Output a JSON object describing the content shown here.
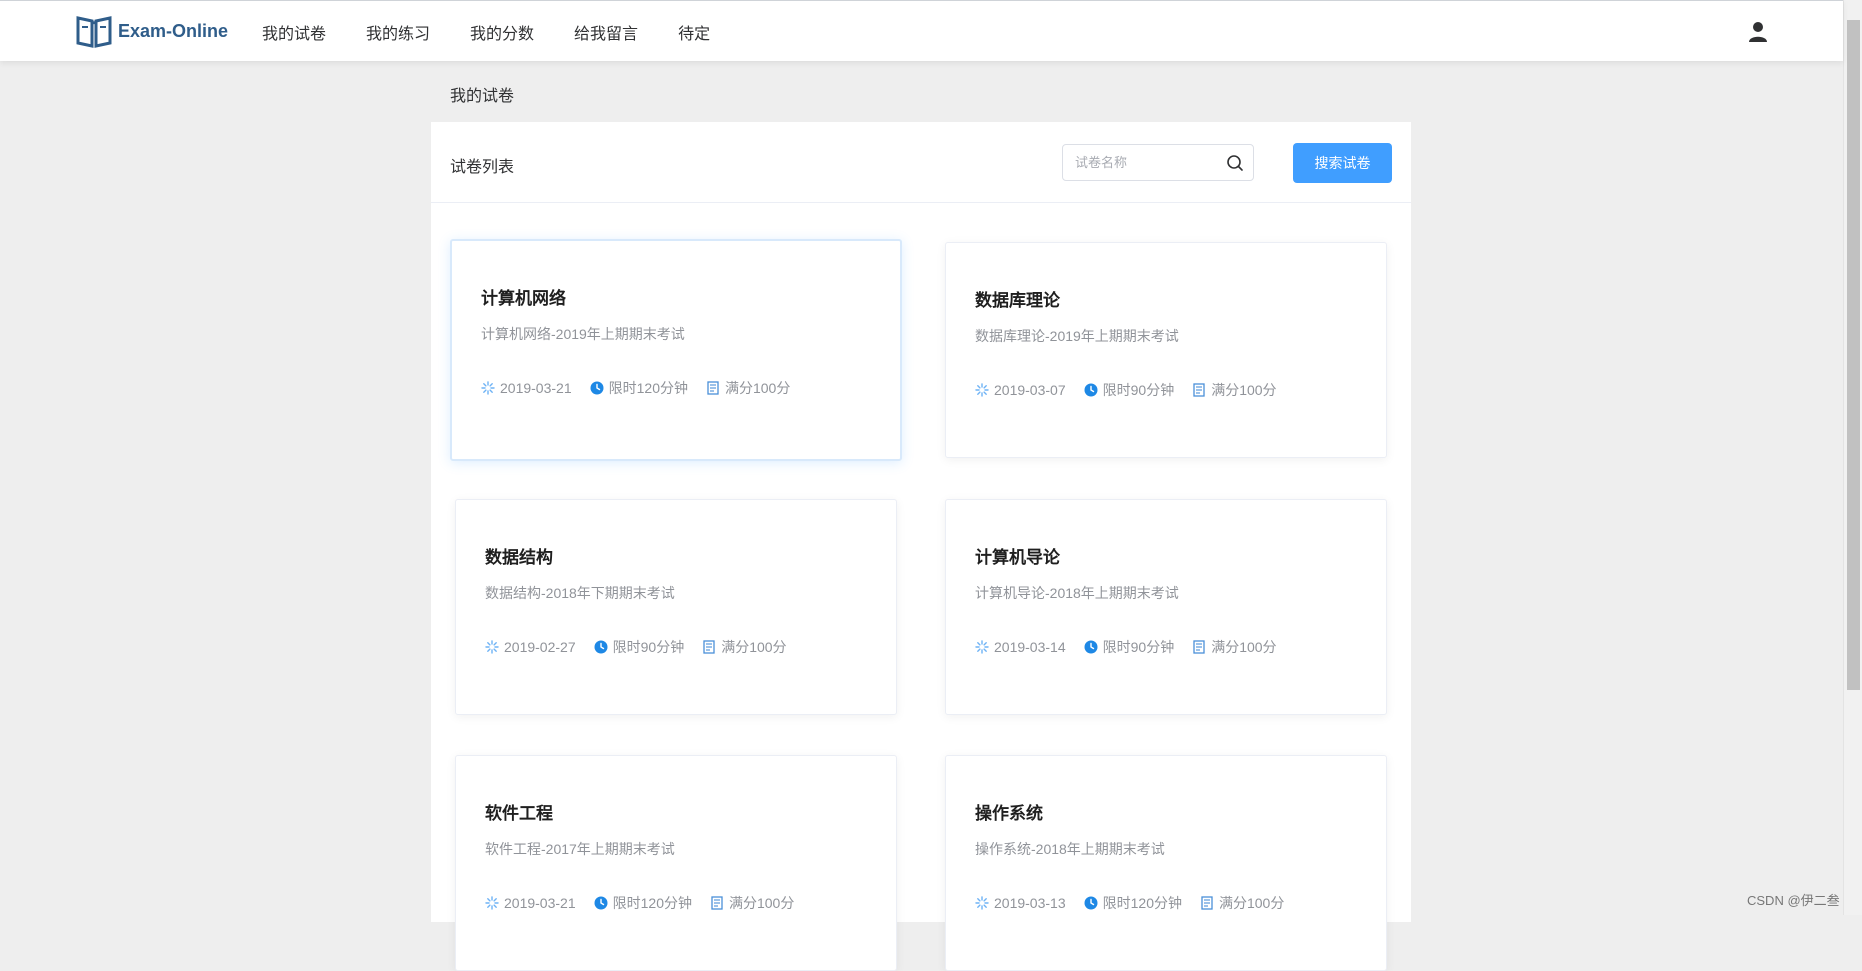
{
  "app": {
    "logo_text": "Exam-Online"
  },
  "nav": {
    "items": [
      {
        "label": "我的试卷"
      },
      {
        "label": "我的练习"
      },
      {
        "label": "我的分数"
      },
      {
        "label": "给我留言"
      },
      {
        "label": "待定"
      }
    ]
  },
  "breadcrumb": "我的试卷",
  "panel": {
    "title": "试卷列表",
    "search_placeholder": "试卷名称",
    "search_value": "",
    "search_button": "搜索试卷"
  },
  "papers": [
    {
      "title": "计算机网络",
      "desc": "计算机网络-2019年上期期末考试",
      "date": "2019-03-21",
      "limit": "限时120分钟",
      "score": "满分100分"
    },
    {
      "title": "数据库理论",
      "desc": "数据库理论-2019年上期期末考试",
      "date": "2019-03-07",
      "limit": "限时90分钟",
      "score": "满分100分"
    },
    {
      "title": "数据结构",
      "desc": "数据结构-2018年下期期末考试",
      "date": "2019-02-27",
      "limit": "限时90分钟",
      "score": "满分100分"
    },
    {
      "title": "计算机导论",
      "desc": "计算机导论-2018年上期期末考试",
      "date": "2019-03-14",
      "limit": "限时90分钟",
      "score": "满分100分"
    },
    {
      "title": "软件工程",
      "desc": "软件工程-2017年上期期末考试",
      "date": "2019-03-21",
      "limit": "限时120分钟",
      "score": "满分100分"
    },
    {
      "title": "操作系统",
      "desc": "操作系统-2018年上期期末考试",
      "date": "2019-03-13",
      "limit": "限时120分钟",
      "score": "满分100分"
    }
  ],
  "icons": {
    "logo": "book-icon",
    "user": "user-icon",
    "search": "search-icon",
    "date": "sun-icon",
    "limit": "clock-icon",
    "score": "document-icon"
  },
  "colors": {
    "accent": "#409eff",
    "logo": "#2f5d8a"
  },
  "watermark": "CSDN @伊二叁"
}
